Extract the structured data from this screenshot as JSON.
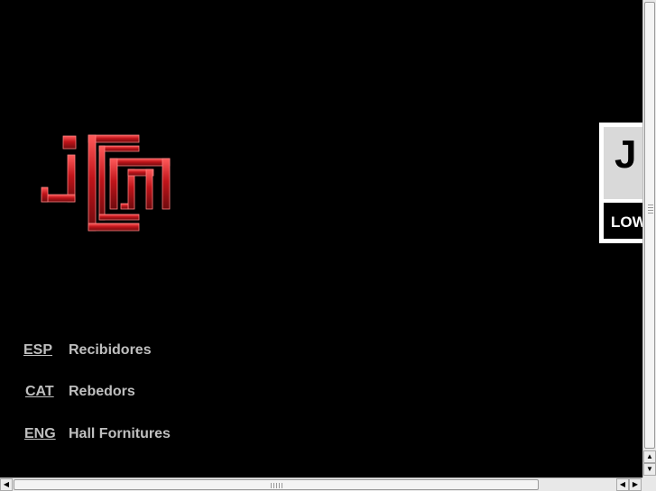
{
  "logo": {
    "text": "jCm",
    "color": "#c0141a",
    "icon": "jcm-logo"
  },
  "banner": {
    "letter": "J",
    "text": "LOW"
  },
  "languages": [
    {
      "code": "ESP",
      "label": "Recibidores"
    },
    {
      "code": "CAT",
      "label": "Rebedors"
    },
    {
      "code": "ENG",
      "label": "Hall Fornitures"
    }
  ],
  "scrollbars": {
    "vertical": {
      "up_icon": "arrow-up-icon",
      "down_icon": "arrow-down-icon"
    },
    "horizontal": {
      "left_icon": "arrow-left-icon",
      "right_icon": "arrow-right-icon"
    }
  }
}
